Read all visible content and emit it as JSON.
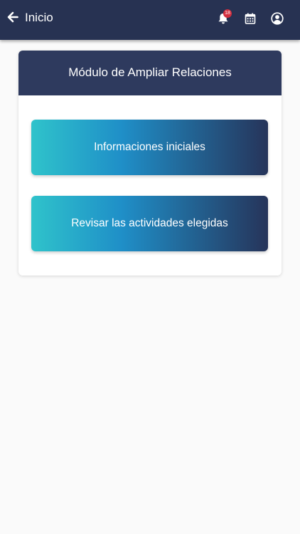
{
  "topbar": {
    "title": "Inicio",
    "notifications_count": "18",
    "icons": {
      "back": "arrow-left-icon",
      "notifications": "bell-icon",
      "calendar": "calendar-icon",
      "profile": "user-circle-icon"
    }
  },
  "module": {
    "title": "Módulo de Ampliar Relaciones",
    "buttons": [
      {
        "label": "Informaciones iniciales"
      },
      {
        "label": "Revisar las actividades elegidas"
      }
    ]
  },
  "colors": {
    "topbar_bg": "#273252",
    "card_header_bg": "#2e3a5e",
    "gradient_start": "#2fc3cb",
    "gradient_mid": "#1f8fc8",
    "gradient_end": "#26345a",
    "badge": "#d32f3f",
    "page_bg": "#fafafa"
  }
}
